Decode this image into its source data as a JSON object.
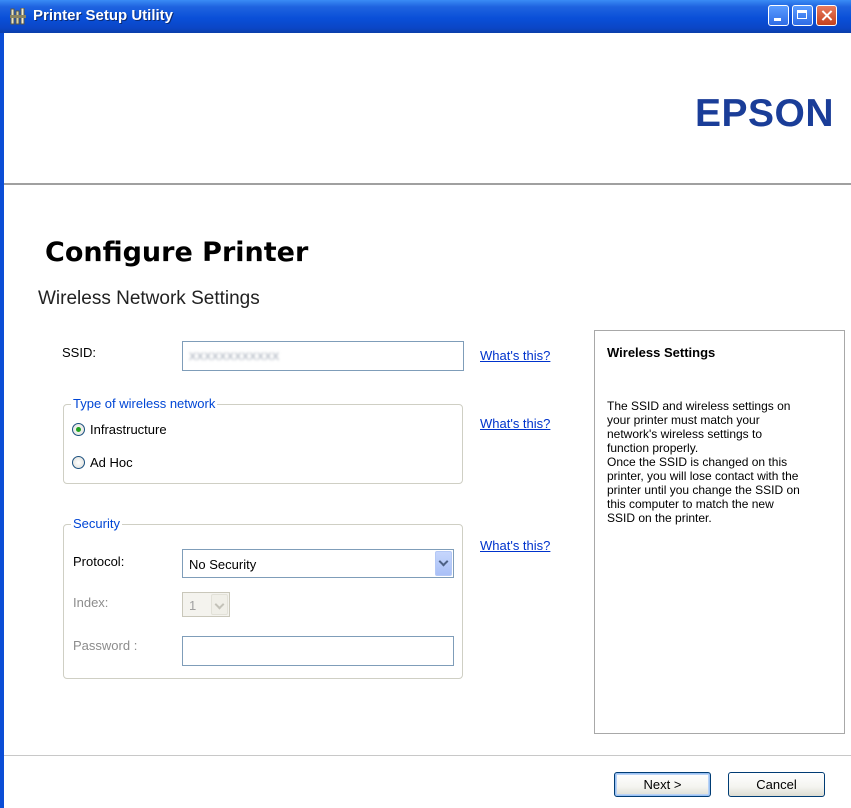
{
  "window": {
    "title": "Printer Setup Utility",
    "controls": {
      "minimize": "minimize-icon",
      "maximize": "maximize-icon",
      "close": "close-icon"
    }
  },
  "header": {
    "brand": "EPSON"
  },
  "page": {
    "title": "Configure Printer",
    "subtitle": "Wireless Network Settings"
  },
  "ssid": {
    "label": "SSID:",
    "value": "XXXXXXXXXXXX",
    "help_link": "What's this?"
  },
  "network_type": {
    "legend": "Type of wireless network",
    "options": [
      {
        "label": "Infrastructure",
        "selected": true
      },
      {
        "label": "Ad Hoc",
        "selected": false
      }
    ],
    "help_link": "What's this?"
  },
  "security": {
    "legend": "Security",
    "protocol_label": "Protocol:",
    "protocol_value": "No Security",
    "index_label": "Index:",
    "index_value": "1",
    "password_label": "Password :",
    "password_value": "",
    "help_link": "What's this?"
  },
  "info_panel": {
    "title": "Wireless Settings",
    "body": "The SSID and wireless settings on\nyour printer must match your\nnetwork's wireless settings to\nfunction properly.\nOnce the SSID is changed on this\nprinter, you will lose contact with the\nprinter until you change the SSID on\nthis computer to match the new\nSSID on the printer."
  },
  "footer": {
    "next_label": "Next >",
    "cancel_label": "Cancel"
  },
  "colors": {
    "titlebar": "#0a4fd8",
    "brand": "#1a3d98",
    "link": "#0033cc",
    "legend": "#0046d5"
  }
}
